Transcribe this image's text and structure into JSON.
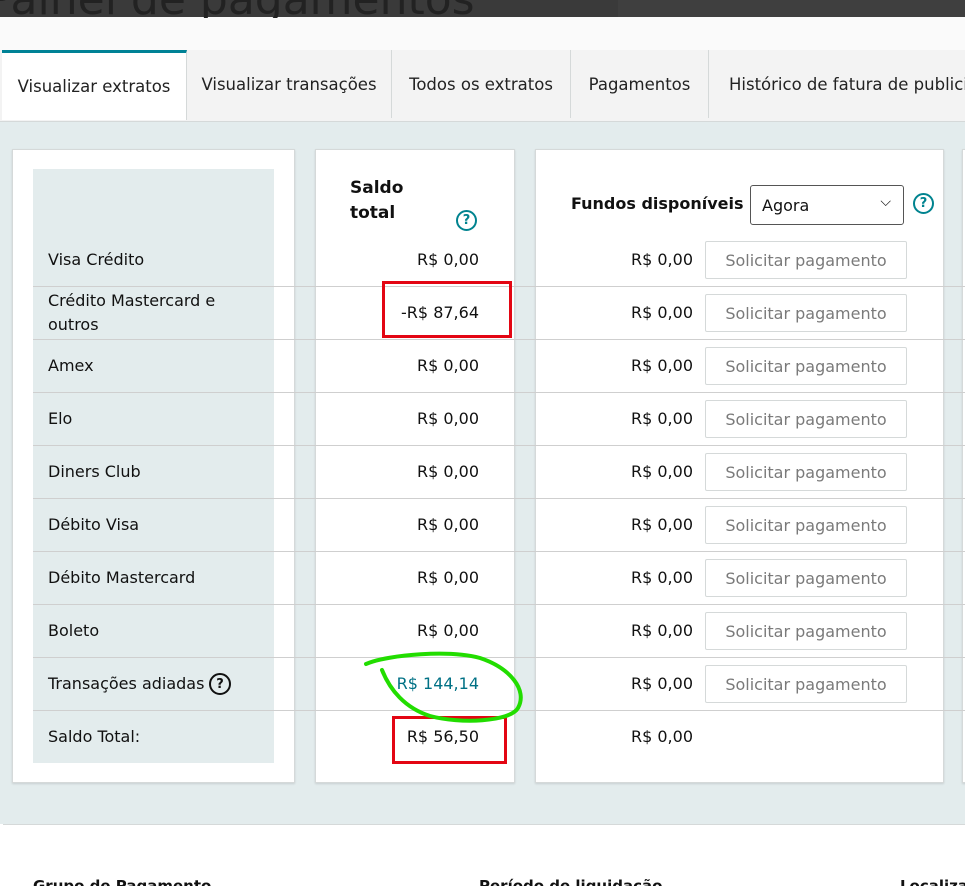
{
  "page_title": "Painel de pagamentos",
  "tabs": [
    {
      "label": "Visualizar extratos",
      "active": true
    },
    {
      "label": "Visualizar transações",
      "active": false
    },
    {
      "label": "Todos os extratos",
      "active": false
    },
    {
      "label": "Pagamentos",
      "active": false
    },
    {
      "label": "Histórico de fatura de publicidade",
      "active": false
    }
  ],
  "balance": {
    "column_header": "Saldo total",
    "funds_label": "Fundos disponíveis",
    "funds_select_value": "Agora",
    "request_button_label": "Solicitar pagamento",
    "rows": [
      {
        "label": "Visa Crédito",
        "total": "R$ 0,00",
        "funds": "R$ 0,00"
      },
      {
        "label": "Crédito Mastercard e outros",
        "total": "-R$ 87,64",
        "funds": "R$ 0,00"
      },
      {
        "label": "Amex",
        "total": "R$ 0,00",
        "funds": "R$ 0,00"
      },
      {
        "label": "Elo",
        "total": "R$ 0,00",
        "funds": "R$ 0,00"
      },
      {
        "label": "Diners Club",
        "total": "R$ 0,00",
        "funds": "R$ 0,00"
      },
      {
        "label": "Débito Visa",
        "total": "R$ 0,00",
        "funds": "R$ 0,00"
      },
      {
        "label": "Débito Mastercard",
        "total": "R$ 0,00",
        "funds": "R$ 0,00"
      },
      {
        "label": "Boleto",
        "total": "R$ 0,00",
        "funds": "R$ 0,00"
      },
      {
        "label": "Transações adiadas",
        "total": "R$ 144,14",
        "funds": "R$ 0,00"
      },
      {
        "label": "Saldo Total:",
        "total": "R$ 56,50",
        "funds": "R$ 0,00"
      }
    ]
  },
  "lower_headers": [
    "Grupo de Pagamento",
    "Período de liquidação",
    "Localização"
  ],
  "colors": {
    "accent": "#008296",
    "link": "#007185",
    "annotation_red": "#e30613",
    "annotation_green": "#22dd00"
  }
}
